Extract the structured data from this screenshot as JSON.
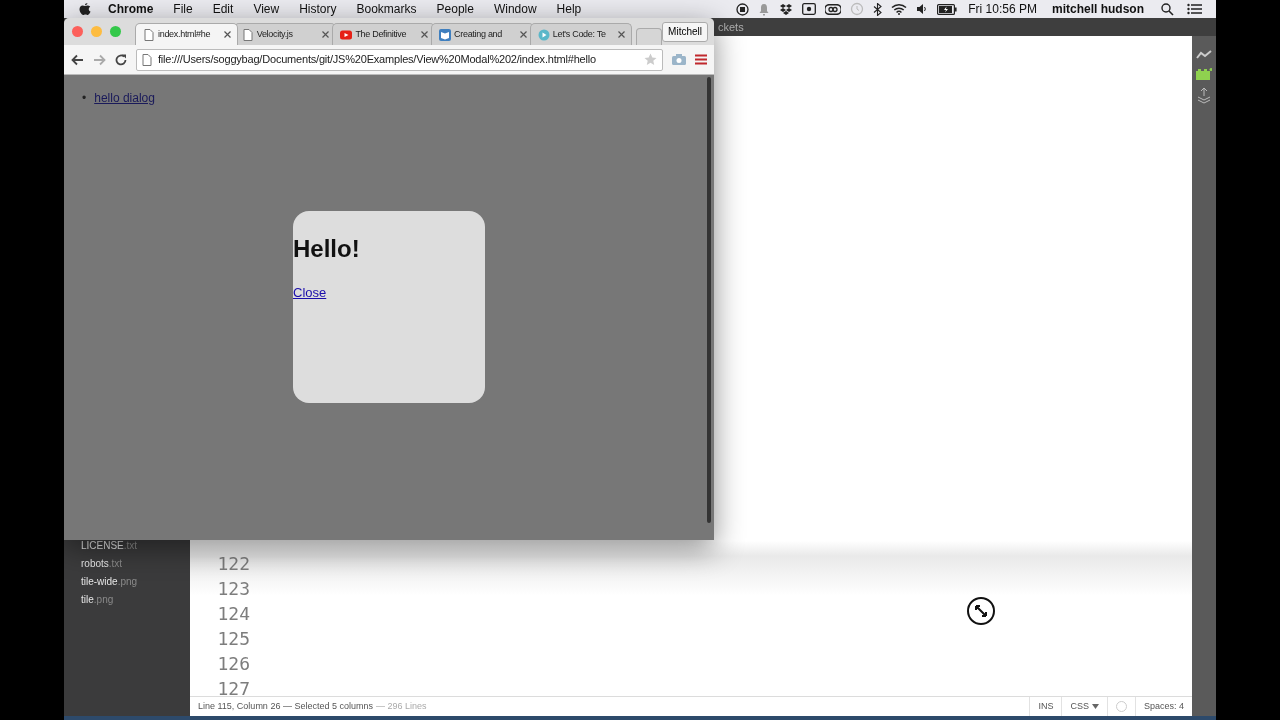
{
  "menu_bar": {
    "app": "Chrome",
    "menus": [
      "File",
      "Edit",
      "View",
      "History",
      "Bookmarks",
      "People",
      "Window",
      "Help"
    ],
    "clock": "Fri 10:56 PM",
    "user": "mitchell hudson"
  },
  "editor_window": {
    "title": "ckets",
    "files": [
      {
        "name": "LICENSE",
        "ext": ".txt"
      },
      {
        "name": "robots",
        "ext": ".txt"
      },
      {
        "name": "tile-wide",
        "ext": ".png"
      },
      {
        "name": "tile",
        "ext": ".png"
      }
    ],
    "lines": [
      {
        "number": "122"
      },
      {
        "number": "123"
      },
      {
        "number": "124"
      },
      {
        "number": "125"
      },
      {
        "number": "126"
      },
      {
        "number": "127"
      }
    ],
    "status_bar": {
      "position": "Line 115, Column 26 — Selected 5 columns",
      "line_count": "— 296 Lines",
      "mode": "INS",
      "language": "CSS",
      "indent": "Spaces: 4"
    }
  },
  "browser": {
    "tabs": [
      {
        "title": "index.html#he",
        "kind": "page",
        "selected": true
      },
      {
        "title": "Velocity.js",
        "kind": "page",
        "selected": false
      },
      {
        "title": "The Definitive",
        "kind": "video",
        "selected": false
      },
      {
        "title": "Creating and",
        "kind": "book",
        "selected": false
      },
      {
        "title": "Let's Code: Te",
        "kind": "play",
        "selected": false
      }
    ],
    "profile": "Mitchell",
    "address": "file:///Users/soggybag/Documents/git/JS%20Examples/View%20Modal%202/index.html#hello",
    "page": {
      "links": [
        {
          "bullet": "•",
          "label": "hello dialog"
        }
      ],
      "dialog": {
        "heading": "Hello!",
        "link": "Close"
      }
    }
  }
}
